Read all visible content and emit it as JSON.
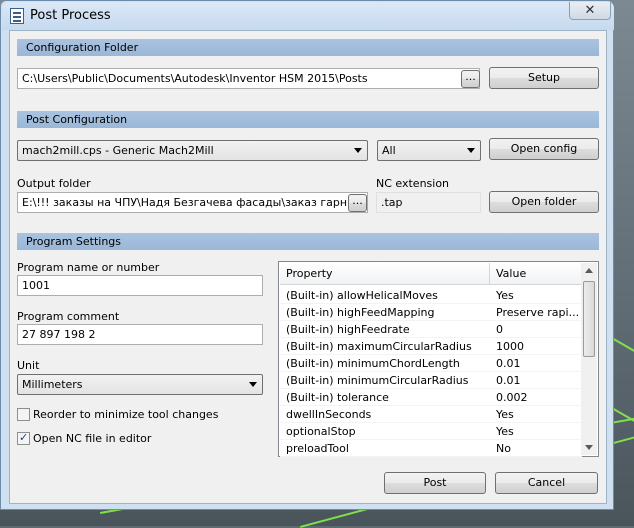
{
  "window": {
    "title": "Post Process",
    "close_glyph": "✕"
  },
  "config_folder": {
    "header": "Configuration Folder",
    "path": "C:\\Users\\Public\\Documents\\Autodesk\\Inventor HSM 2015\\Posts",
    "browse_label": "...",
    "setup_label": "Setup"
  },
  "post_config": {
    "header": "Post Configuration",
    "post_selected": "mach2mill.cps - Generic Mach2Mill",
    "filter_selected": "All",
    "open_config_label": "Open config",
    "output_folder_label": "Output folder",
    "output_folder_value": "E:\\!!! заказы на ЧПУ\\Надя Безгачева фасады\\заказ гарнитур\\фасады",
    "output_browse_label": "...",
    "nc_extension_label": "NC extension",
    "nc_extension_value": ".tap",
    "open_folder_label": "Open folder"
  },
  "program_settings": {
    "header": "Program Settings",
    "program_name_label": "Program name or number",
    "program_name_value": "1001",
    "program_comment_label": "Program comment",
    "program_comment_value": "27 897 198 2",
    "unit_label": "Unit",
    "unit_selected": "Millimeters",
    "reorder_label": "Reorder to minimize tool changes",
    "reorder_checked": false,
    "open_nc_label": "Open NC file in editor",
    "open_nc_checked": true
  },
  "properties": {
    "columns": [
      "Property",
      "Value"
    ],
    "rows": [
      [
        "(Built-in) allowHelicalMoves",
        "Yes"
      ],
      [
        "(Built-in) highFeedMapping",
        "Preserve rapi..."
      ],
      [
        "(Built-in) highFeedrate",
        "0"
      ],
      [
        "(Built-in) maximumCircularRadius",
        "1000"
      ],
      [
        "(Built-in) minimumChordLength",
        "0.01"
      ],
      [
        "(Built-in) minimumCircularRadius",
        "0.01"
      ],
      [
        "(Built-in) tolerance",
        "0.002"
      ],
      [
        "dwellInSeconds",
        "Yes"
      ],
      [
        "optionalStop",
        "Yes"
      ],
      [
        "preloadTool",
        "No"
      ]
    ]
  },
  "footer": {
    "post_label": "Post",
    "cancel_label": "Cancel"
  }
}
